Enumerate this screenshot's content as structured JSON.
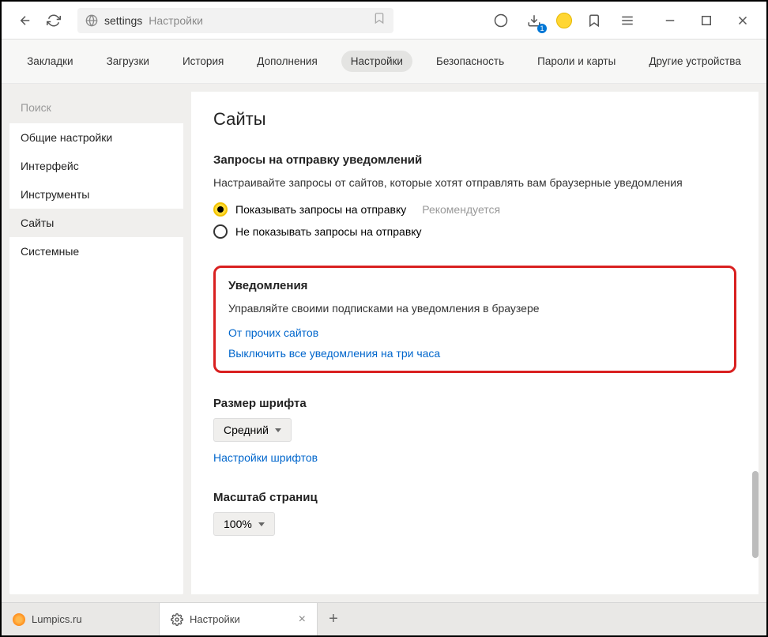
{
  "toolbar": {
    "address_protocol": "settings",
    "address_title": "Настройки",
    "downloads_badge": "1"
  },
  "topnav": {
    "items": [
      {
        "label": "Закладки",
        "active": false
      },
      {
        "label": "Загрузки",
        "active": false
      },
      {
        "label": "История",
        "active": false
      },
      {
        "label": "Дополнения",
        "active": false
      },
      {
        "label": "Настройки",
        "active": true
      },
      {
        "label": "Безопасность",
        "active": false
      },
      {
        "label": "Пароли и карты",
        "active": false
      },
      {
        "label": "Другие устройства",
        "active": false
      }
    ]
  },
  "sidebar": {
    "search_placeholder": "Поиск",
    "items": [
      {
        "label": "Общие настройки",
        "active": false
      },
      {
        "label": "Интерфейс",
        "active": false
      },
      {
        "label": "Инструменты",
        "active": false
      },
      {
        "label": "Сайты",
        "active": true
      },
      {
        "label": "Системные",
        "active": false
      }
    ]
  },
  "content": {
    "page_title": "Сайты",
    "requests": {
      "title": "Запросы на отправку уведомлений",
      "desc": "Настраивайте запросы от сайтов, которые хотят отправлять вам браузерные уведомления",
      "option1": "Показывать запросы на отправку",
      "option1_hint": "Рекомендуется",
      "option2": "Не показывать запросы на отправку"
    },
    "notifications": {
      "title": "Уведомления",
      "desc": "Управляйте своими подписками на уведомления в браузере",
      "link1": "От прочих сайтов",
      "link2": "Выключить все уведомления на три часа"
    },
    "fontsize": {
      "title": "Размер шрифта",
      "value": "Средний",
      "link": "Настройки шрифтов"
    },
    "zoom": {
      "title": "Масштаб страниц",
      "value": "100%"
    }
  },
  "tabs": {
    "items": [
      {
        "label": "Lumpics.ru",
        "active": false
      },
      {
        "label": "Настройки",
        "active": true
      }
    ]
  }
}
